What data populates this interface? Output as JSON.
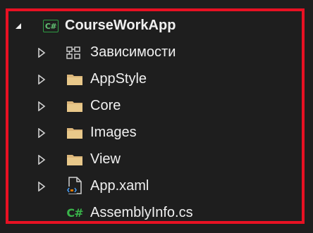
{
  "project": {
    "name": "CourseWorkApp",
    "icon": "csharp-project-icon",
    "expanded": true
  },
  "items": [
    {
      "label": "Зависимости",
      "icon": "dependencies-icon",
      "collapsed": true
    },
    {
      "label": "AppStyle",
      "icon": "folder-icon",
      "collapsed": true
    },
    {
      "label": "Core",
      "icon": "folder-icon",
      "collapsed": true
    },
    {
      "label": "Images",
      "icon": "folder-icon",
      "collapsed": true
    },
    {
      "label": "View",
      "icon": "folder-icon",
      "collapsed": true
    },
    {
      "label": "App.xaml",
      "icon": "xaml-file-icon",
      "collapsed": true
    },
    {
      "label": "AssemblyInfo.cs",
      "icon": "csharp-file-icon",
      "collapsed": false
    }
  ],
  "colors": {
    "background": "#1e1e1e",
    "highlight_border": "#e81123",
    "text": "#f0f0f0",
    "folder": "#dcb67a",
    "csharp": "#39b54a"
  },
  "icon_glyphs": {
    "csharp_badge": "C#",
    "csharp_file": "C#"
  }
}
